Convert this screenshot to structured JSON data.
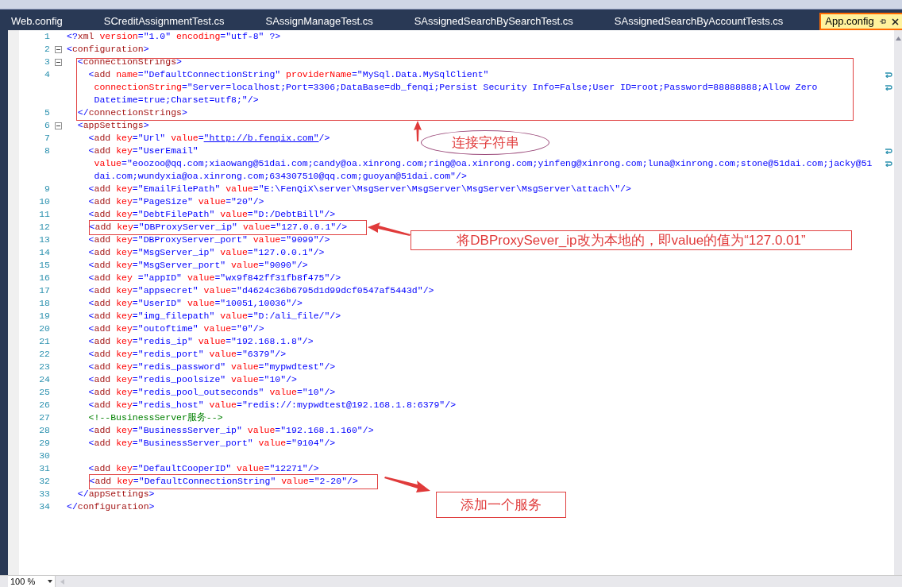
{
  "tabs": [
    {
      "label": "Web.config",
      "selected": false
    },
    {
      "label": "SCreditAssignmentTest.cs",
      "selected": false
    },
    {
      "label": "SAssignManageTest.cs",
      "selected": false
    },
    {
      "label": "SAssignedSearchBySearchTest.cs",
      "selected": false
    },
    {
      "label": "SAssignedSearchByAccountTests.cs",
      "selected": false
    },
    {
      "label": "App.config",
      "selected": true
    }
  ],
  "editor": {
    "lines": [
      {
        "number": "1",
        "rows": [
          "<?xml version=\"1.0\" encoding=\"utf-8\" ?>"
        ]
      },
      {
        "number": "2",
        "expanded": true,
        "rows": [
          "<configuration>"
        ]
      },
      {
        "number": "3",
        "expanded": true,
        "rows": [
          "  <connectionStrings>"
        ]
      },
      {
        "number": "4",
        "rows": [
          "    <add name=\"DefaultConnectionString\" providerName=\"MySql.Data.MySqlClient\"",
          "     connectionString=\"Server=localhost;Port=3306;DataBase=db_fenqi;Persist Security Info=False;User ID=root;Password=88888888;Allow Zero",
          "     Datetime=true;Charset=utf8;\"/>"
        ]
      },
      {
        "number": "5",
        "rows": [
          "  </connectionStrings>"
        ]
      },
      {
        "number": "6",
        "expanded": true,
        "rows": [
          "  <appSettings>"
        ]
      },
      {
        "number": "7",
        "rows": [
          "    <add key=\"Url\" value=\"http://b.fenqix.com\"/>"
        ]
      },
      {
        "number": "8",
        "rows": [
          "    <add key=\"UserEmail\"",
          "     value=\"eoozoo@qq.com;xiaowang@51dai.com;candy@oa.xinrong.com;ring@oa.xinrong.com;yinfeng@xinrong.com;luna@xinrong.com;stone@51dai.com;jacky@51",
          "     dai.com;wundyxia@oa.xinrong.com;634307510@qq.com;guoyan@51dai.com\"/>"
        ]
      },
      {
        "number": "9",
        "rows": [
          "    <add key=\"EmailFilePath\" value=\"E:\\FenQiX\\server\\MsgServer\\MsgServer\\MsgServer\\MsgServer\\attach\\\"/>"
        ]
      },
      {
        "number": "10",
        "rows": [
          "    <add key=\"PageSize\" value=\"20\"/>"
        ]
      },
      {
        "number": "11",
        "rows": [
          "    <add key=\"DebtFilePath\" value=\"D:/DebtBill\"/>"
        ]
      },
      {
        "number": "12",
        "framed": true,
        "rows": [
          "    <add key=\"DBProxyServer_ip\" value=\"127.0.0.1\"/>"
        ]
      },
      {
        "number": "13",
        "rows": [
          "    <add key=\"DBProxyServer_port\" value=\"9099\"/>"
        ]
      },
      {
        "number": "14",
        "rows": [
          "    <add key=\"MsgServer_ip\" value=\"127.0.0.1\"/>"
        ]
      },
      {
        "number": "15",
        "rows": [
          "    <add key=\"MsgServer_port\" value=\"9090\"/>"
        ]
      },
      {
        "number": "16",
        "rows": [
          "    <add key =\"appID\" value=\"wx9f842ff31fb8f475\"/>"
        ]
      },
      {
        "number": "17",
        "rows": [
          "    <add key=\"appsecret\" value=\"d4624c36b6795d1d99dcf0547af5443d\"/>"
        ]
      },
      {
        "number": "18",
        "rows": [
          "    <add key=\"UserID\" value=\"10051,10036\"/>"
        ]
      },
      {
        "number": "19",
        "rows": [
          "    <add key=\"img_filepath\" value=\"D:/ali_file/\"/>"
        ]
      },
      {
        "number": "20",
        "rows": [
          "    <add key=\"outoftime\" value=\"0\"/>"
        ]
      },
      {
        "number": "21",
        "rows": [
          "    <add key=\"redis_ip\" value=\"192.168.1.8\"/>"
        ]
      },
      {
        "number": "22",
        "rows": [
          "    <add key=\"redis_port\" value=\"6379\"/>"
        ]
      },
      {
        "number": "23",
        "rows": [
          "    <add key=\"redis_password\" value=\"mypwdtest\"/>"
        ]
      },
      {
        "number": "24",
        "rows": [
          "    <add key=\"redis_poolsize\" value=\"10\"/>"
        ]
      },
      {
        "number": "25",
        "rows": [
          "    <add key=\"redis_pool_outseconds\" value=\"10\"/>"
        ]
      },
      {
        "number": "26",
        "rows": [
          "    <add key=\"redis_host\" value=\"redis://:mypwdtest@192.168.1.8:6379\"/>"
        ]
      },
      {
        "number": "27",
        "rows": [
          "    <!--BusinessServer服务-->"
        ]
      },
      {
        "number": "28",
        "rows": [
          "    <add key=\"BusinessServer_ip\" value=\"192.168.1.160\"/>"
        ]
      },
      {
        "number": "29",
        "rows": [
          "    <add key=\"BusinessServer_port\" value=\"9104\"/>"
        ]
      },
      {
        "number": "30"
      },
      {
        "number": "31",
        "rows": [
          "    <add key=\"DefaultCooperID\" value=\"12271\"/>"
        ]
      },
      {
        "number": "32",
        "framed": true,
        "rows": [
          "    <add key=\"DefaultConnectionString\" value=\"2-20\"/>"
        ]
      },
      {
        "number": "33",
        "rows": [
          "  </appSettings>"
        ]
      },
      {
        "number": "34",
        "rows": [
          "</configuration>"
        ]
      }
    ]
  },
  "annotations": [
    {
      "kind": "ellipse",
      "text": "连接字符串"
    },
    {
      "kind": "box",
      "text": "将DBProxySever_ip改为本地的，即value的值为“127.0.01”"
    },
    {
      "kind": "box",
      "text": "添加一个服务"
    }
  ],
  "status_bar": {
    "zoom": "100 %"
  }
}
